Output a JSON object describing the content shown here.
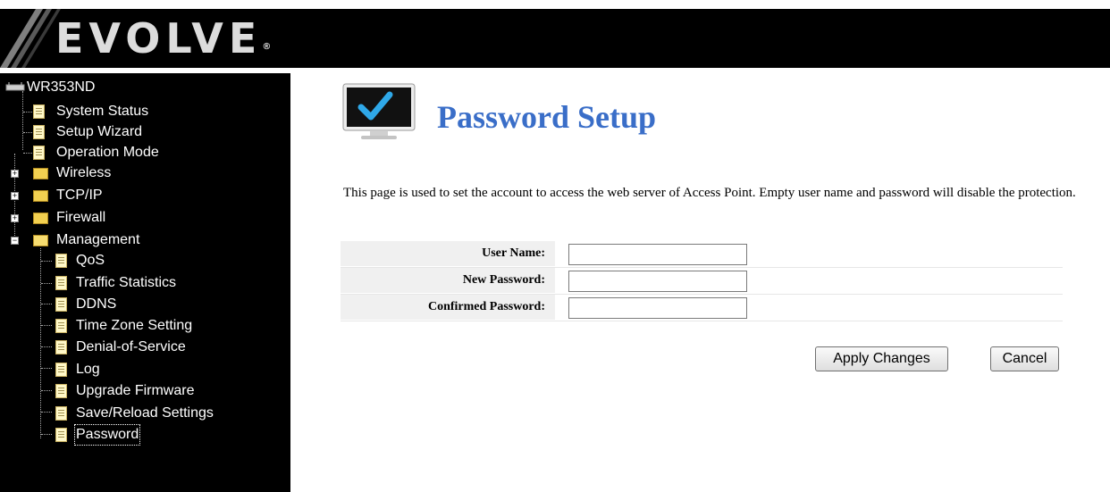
{
  "brand": {
    "name": "EVOLVE",
    "mark": "®"
  },
  "tree": {
    "root": "WR353ND",
    "items": [
      {
        "label": "System Status"
      },
      {
        "label": "Setup Wizard"
      },
      {
        "label": "Operation Mode"
      },
      {
        "label": "Wireless"
      },
      {
        "label": "TCP/IP"
      },
      {
        "label": "Firewall"
      },
      {
        "label": "Management"
      },
      {
        "label": "QoS"
      },
      {
        "label": "Traffic Statistics"
      },
      {
        "label": "DDNS"
      },
      {
        "label": "Time Zone Setting"
      },
      {
        "label": "Denial-of-Service"
      },
      {
        "label": "Log"
      },
      {
        "label": "Upgrade Firmware"
      },
      {
        "label": "Save/Reload Settings"
      },
      {
        "label": "Password"
      }
    ]
  },
  "page": {
    "title": "Password Setup",
    "description": "This page is used to set the account to access the web server of Access Point. Empty user name and password will disable the protection."
  },
  "form": {
    "user_name": {
      "label": "User Name:",
      "value": ""
    },
    "new_password": {
      "label": "New Password:",
      "value": ""
    },
    "confirmed_password": {
      "label": "Confirmed Password:",
      "value": ""
    }
  },
  "buttons": {
    "apply": "Apply Changes",
    "cancel": "Cancel"
  }
}
